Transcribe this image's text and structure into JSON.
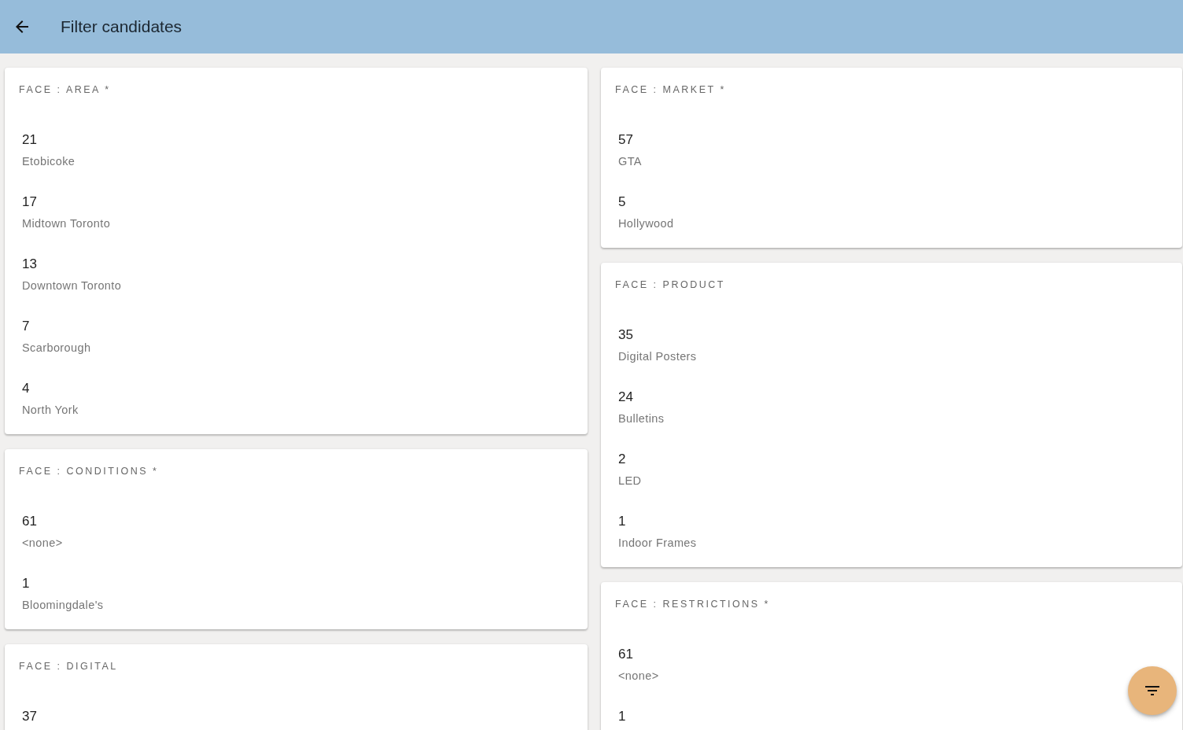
{
  "app_bar": {
    "title": "Filter candidates"
  },
  "columns": [
    {
      "facets": [
        {
          "title": "FACE : AREA *",
          "options": [
            {
              "count": "21",
              "label": "Etobicoke"
            },
            {
              "count": "17",
              "label": "Midtown Toronto"
            },
            {
              "count": "13",
              "label": "Downtown Toronto"
            },
            {
              "count": "7",
              "label": "Scarborough"
            },
            {
              "count": "4",
              "label": "North York"
            }
          ]
        },
        {
          "title": "FACE : CONDITIONS *",
          "options": [
            {
              "count": "61",
              "label": "<none>"
            },
            {
              "count": "1",
              "label": "Bloomingdale's"
            }
          ]
        },
        {
          "title": "FACE : DIGITAL",
          "options": [
            {
              "count": "37"
            }
          ]
        }
      ]
    },
    {
      "facets": [
        {
          "title": "FACE : MARKET *",
          "options": [
            {
              "count": "57",
              "label": "GTA"
            },
            {
              "count": "5",
              "label": "Hollywood"
            }
          ]
        },
        {
          "title": "FACE : PRODUCT",
          "options": [
            {
              "count": "35",
              "label": "Digital Posters"
            },
            {
              "count": "24",
              "label": "Bulletins"
            },
            {
              "count": "2",
              "label": "LED"
            },
            {
              "count": "1",
              "label": "Indoor Frames"
            }
          ]
        },
        {
          "title": "FACE : RESTRICTIONS *",
          "options": [
            {
              "count": "61",
              "label": "<none>"
            },
            {
              "count": "1"
            }
          ]
        }
      ]
    }
  ]
}
